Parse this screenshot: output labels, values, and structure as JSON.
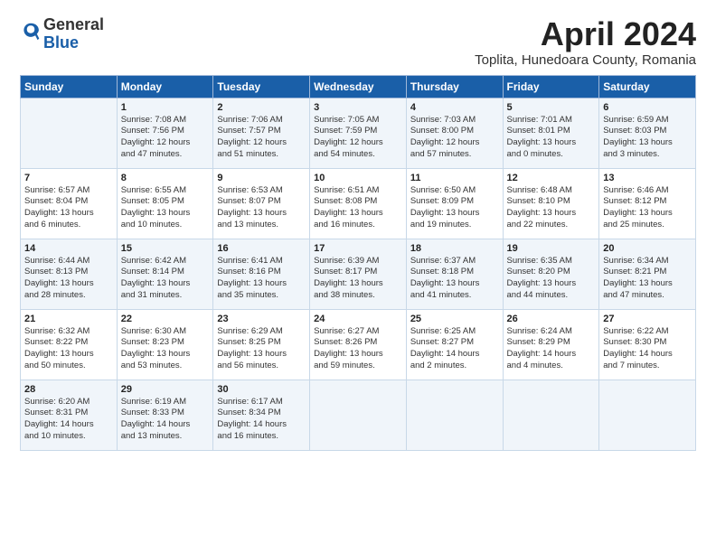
{
  "logo": {
    "general": "General",
    "blue": "Blue"
  },
  "title": "April 2024",
  "location": "Toplita, Hunedoara County, Romania",
  "days_header": [
    "Sunday",
    "Monday",
    "Tuesday",
    "Wednesday",
    "Thursday",
    "Friday",
    "Saturday"
  ],
  "weeks": [
    [
      {
        "day": "",
        "lines": []
      },
      {
        "day": "1",
        "lines": [
          "Sunrise: 7:08 AM",
          "Sunset: 7:56 PM",
          "Daylight: 12 hours",
          "and 47 minutes."
        ]
      },
      {
        "day": "2",
        "lines": [
          "Sunrise: 7:06 AM",
          "Sunset: 7:57 PM",
          "Daylight: 12 hours",
          "and 51 minutes."
        ]
      },
      {
        "day": "3",
        "lines": [
          "Sunrise: 7:05 AM",
          "Sunset: 7:59 PM",
          "Daylight: 12 hours",
          "and 54 minutes."
        ]
      },
      {
        "day": "4",
        "lines": [
          "Sunrise: 7:03 AM",
          "Sunset: 8:00 PM",
          "Daylight: 12 hours",
          "and 57 minutes."
        ]
      },
      {
        "day": "5",
        "lines": [
          "Sunrise: 7:01 AM",
          "Sunset: 8:01 PM",
          "Daylight: 13 hours",
          "and 0 minutes."
        ]
      },
      {
        "day": "6",
        "lines": [
          "Sunrise: 6:59 AM",
          "Sunset: 8:03 PM",
          "Daylight: 13 hours",
          "and 3 minutes."
        ]
      }
    ],
    [
      {
        "day": "7",
        "lines": [
          "Sunrise: 6:57 AM",
          "Sunset: 8:04 PM",
          "Daylight: 13 hours",
          "and 6 minutes."
        ]
      },
      {
        "day": "8",
        "lines": [
          "Sunrise: 6:55 AM",
          "Sunset: 8:05 PM",
          "Daylight: 13 hours",
          "and 10 minutes."
        ]
      },
      {
        "day": "9",
        "lines": [
          "Sunrise: 6:53 AM",
          "Sunset: 8:07 PM",
          "Daylight: 13 hours",
          "and 13 minutes."
        ]
      },
      {
        "day": "10",
        "lines": [
          "Sunrise: 6:51 AM",
          "Sunset: 8:08 PM",
          "Daylight: 13 hours",
          "and 16 minutes."
        ]
      },
      {
        "day": "11",
        "lines": [
          "Sunrise: 6:50 AM",
          "Sunset: 8:09 PM",
          "Daylight: 13 hours",
          "and 19 minutes."
        ]
      },
      {
        "day": "12",
        "lines": [
          "Sunrise: 6:48 AM",
          "Sunset: 8:10 PM",
          "Daylight: 13 hours",
          "and 22 minutes."
        ]
      },
      {
        "day": "13",
        "lines": [
          "Sunrise: 6:46 AM",
          "Sunset: 8:12 PM",
          "Daylight: 13 hours",
          "and 25 minutes."
        ]
      }
    ],
    [
      {
        "day": "14",
        "lines": [
          "Sunrise: 6:44 AM",
          "Sunset: 8:13 PM",
          "Daylight: 13 hours",
          "and 28 minutes."
        ]
      },
      {
        "day": "15",
        "lines": [
          "Sunrise: 6:42 AM",
          "Sunset: 8:14 PM",
          "Daylight: 13 hours",
          "and 31 minutes."
        ]
      },
      {
        "day": "16",
        "lines": [
          "Sunrise: 6:41 AM",
          "Sunset: 8:16 PM",
          "Daylight: 13 hours",
          "and 35 minutes."
        ]
      },
      {
        "day": "17",
        "lines": [
          "Sunrise: 6:39 AM",
          "Sunset: 8:17 PM",
          "Daylight: 13 hours",
          "and 38 minutes."
        ]
      },
      {
        "day": "18",
        "lines": [
          "Sunrise: 6:37 AM",
          "Sunset: 8:18 PM",
          "Daylight: 13 hours",
          "and 41 minutes."
        ]
      },
      {
        "day": "19",
        "lines": [
          "Sunrise: 6:35 AM",
          "Sunset: 8:20 PM",
          "Daylight: 13 hours",
          "and 44 minutes."
        ]
      },
      {
        "day": "20",
        "lines": [
          "Sunrise: 6:34 AM",
          "Sunset: 8:21 PM",
          "Daylight: 13 hours",
          "and 47 minutes."
        ]
      }
    ],
    [
      {
        "day": "21",
        "lines": [
          "Sunrise: 6:32 AM",
          "Sunset: 8:22 PM",
          "Daylight: 13 hours",
          "and 50 minutes."
        ]
      },
      {
        "day": "22",
        "lines": [
          "Sunrise: 6:30 AM",
          "Sunset: 8:23 PM",
          "Daylight: 13 hours",
          "and 53 minutes."
        ]
      },
      {
        "day": "23",
        "lines": [
          "Sunrise: 6:29 AM",
          "Sunset: 8:25 PM",
          "Daylight: 13 hours",
          "and 56 minutes."
        ]
      },
      {
        "day": "24",
        "lines": [
          "Sunrise: 6:27 AM",
          "Sunset: 8:26 PM",
          "Daylight: 13 hours",
          "and 59 minutes."
        ]
      },
      {
        "day": "25",
        "lines": [
          "Sunrise: 6:25 AM",
          "Sunset: 8:27 PM",
          "Daylight: 14 hours",
          "and 2 minutes."
        ]
      },
      {
        "day": "26",
        "lines": [
          "Sunrise: 6:24 AM",
          "Sunset: 8:29 PM",
          "Daylight: 14 hours",
          "and 4 minutes."
        ]
      },
      {
        "day": "27",
        "lines": [
          "Sunrise: 6:22 AM",
          "Sunset: 8:30 PM",
          "Daylight: 14 hours",
          "and 7 minutes."
        ]
      }
    ],
    [
      {
        "day": "28",
        "lines": [
          "Sunrise: 6:20 AM",
          "Sunset: 8:31 PM",
          "Daylight: 14 hours",
          "and 10 minutes."
        ]
      },
      {
        "day": "29",
        "lines": [
          "Sunrise: 6:19 AM",
          "Sunset: 8:33 PM",
          "Daylight: 14 hours",
          "and 13 minutes."
        ]
      },
      {
        "day": "30",
        "lines": [
          "Sunrise: 6:17 AM",
          "Sunset: 8:34 PM",
          "Daylight: 14 hours",
          "and 16 minutes."
        ]
      },
      {
        "day": "",
        "lines": []
      },
      {
        "day": "",
        "lines": []
      },
      {
        "day": "",
        "lines": []
      },
      {
        "day": "",
        "lines": []
      }
    ]
  ]
}
